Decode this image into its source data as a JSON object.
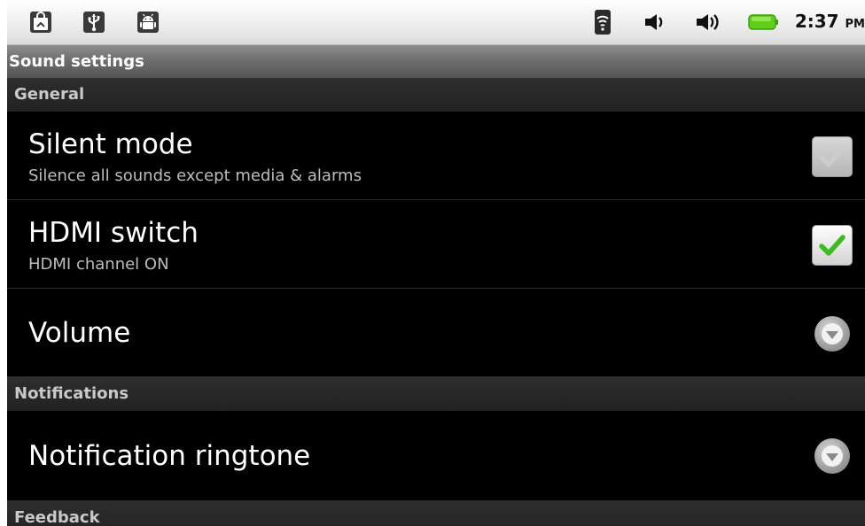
{
  "status_bar": {
    "left_icons": [
      "shopping-bag-icon",
      "usb-icon",
      "android-debug-icon"
    ],
    "right_icons": [
      "wifi-signal-icon",
      "volume-icon",
      "volume-high-icon",
      "battery-icon"
    ],
    "time": "2:37",
    "ampm": "PM",
    "battery_color": "#5fcf1c"
  },
  "title": "Sound settings",
  "sections": {
    "general": "General",
    "notifications": "Notifications",
    "feedback": "Feedback"
  },
  "items": {
    "silent_mode": {
      "title": "Silent mode",
      "summary": "Silence all sounds except media & alarms",
      "checked": true,
      "enabled": false
    },
    "hdmi_switch": {
      "title": "HDMI switch",
      "summary": "HDMI channel ON",
      "checked": true,
      "enabled": true
    },
    "volume": {
      "title": "Volume"
    },
    "notification_ringtone": {
      "title": "Notification ringtone"
    }
  },
  "colors": {
    "checkmark_green": "#3dbb1f",
    "checkmark_disabled": "#c9c9c9"
  }
}
